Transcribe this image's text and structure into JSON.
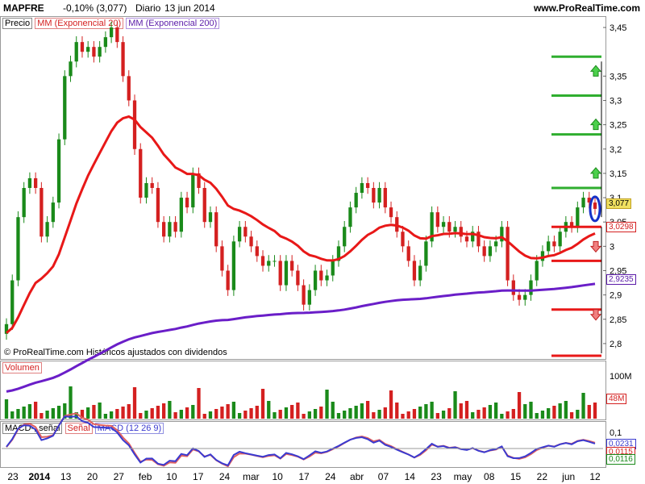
{
  "header": {
    "symbol": "MAPFRE",
    "change": "-0,10% (3,077)",
    "frequency": "Diario",
    "date": "13 jun 2014",
    "site": "www.ProRealTime.com"
  },
  "price_pane": {
    "legend": {
      "price": "Precio",
      "ema20": "MM (Exponencial 20)",
      "ema200": "MM (Exponencial 200)"
    },
    "copyright": "© ProRealTime.com Históricos ajustados con dividendos",
    "tags": {
      "last": "3,077",
      "ema20": "3,0298",
      "ema200": "2,9235"
    }
  },
  "volume_pane": {
    "title": "Volumen",
    "ticks": [
      "100M",
      "48M"
    ]
  },
  "macd_pane": {
    "legend": {
      "macd_signal": "MACD-, señal",
      "signal": "Señal",
      "macd": "MACD (12 26 9)"
    },
    "ticks": [
      "0,1",
      "0,0231",
      "0,0115",
      "0,0116"
    ]
  },
  "colors": {
    "up": "#1a8a1a",
    "down": "#d42020",
    "ema20": "#e81818",
    "ema200": "#6a1ec8",
    "level_green": "#2fae2f",
    "level_red": "#e81818",
    "macd": "#3a3ad0",
    "signal": "#e06060"
  },
  "chart_data": {
    "type": "candlestick",
    "y_ticks": [
      "3,45",
      "3,35",
      "3,3",
      "3,25",
      "3,2",
      "3,15",
      "3,1",
      "3,05",
      "3",
      "2,95",
      "2,9",
      "2,85",
      "2,8"
    ],
    "x_ticks": [
      "23",
      "2014",
      "13",
      "20",
      "27",
      "feb",
      "10",
      "17",
      "24",
      "mar",
      "10",
      "17",
      "24",
      "abr",
      "07",
      "14",
      "23",
      "may",
      "08",
      "15",
      "22",
      "jun",
      "12"
    ],
    "ylim": [
      2.77,
      3.47
    ],
    "closes": [
      2.84,
      2.93,
      3.06,
      3.12,
      3.14,
      3.12,
      3.02,
      3.05,
      3.09,
      3.22,
      3.35,
      3.38,
      3.42,
      3.4,
      3.41,
      3.39,
      3.41,
      3.43,
      3.45,
      3.42,
      3.35,
      3.3,
      3.2,
      3.1,
      3.13,
      3.12,
      3.05,
      3.02,
      3.05,
      3.03,
      3.1,
      3.08,
      3.15,
      3.12,
      3.05,
      3.07,
      3.0,
      2.95,
      2.91,
      3.01,
      3.04,
      3.02,
      3.0,
      2.98,
      2.96,
      2.97,
      2.97,
      2.92,
      2.97,
      2.95,
      2.92,
      2.88,
      2.91,
      2.95,
      2.93,
      2.94,
      2.97,
      3.0,
      3.04,
      3.08,
      3.11,
      3.13,
      3.12,
      3.09,
      3.12,
      3.08,
      3.06,
      3.03,
      3.0,
      2.97,
      2.93,
      2.96,
      3.01,
      3.07,
      3.04,
      3.05,
      3.03,
      3.04,
      3.02,
      3.01,
      3.03,
      3.0,
      2.98,
      3.0,
      3.01,
      3.04,
      2.93,
      2.9,
      2.89,
      2.9,
      2.93,
      2.97,
      2.99,
      3.01,
      3.0,
      3.03,
      3.05,
      3.04,
      3.08,
      3.1,
      3.09,
      3.077
    ],
    "ema20_label": "MM (Exponencial 20)",
    "ema200_label": "MM (Exponencial 200)",
    "levels_green": [
      3.39,
      3.31,
      3.23,
      3.12
    ],
    "levels_red": [
      3.04,
      2.97,
      2.87,
      2.775
    ]
  }
}
